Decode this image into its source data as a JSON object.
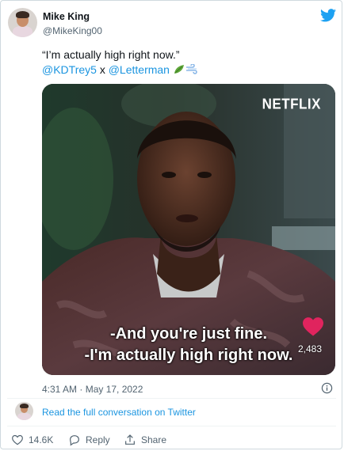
{
  "author": {
    "name": "Mike King",
    "handle": "@MikeKing00"
  },
  "tweet": {
    "line1": "“I’m actually high right now.”",
    "mention1": "@KDTrey5",
    "connector": " x ",
    "mention2": "@Letterman"
  },
  "media": {
    "brand": "NETFLIX",
    "subtitle_line1": "-And you're just fine.",
    "subtitle_line2": "-I'm actually high right now.",
    "heart_count": "2,483"
  },
  "timestamp": "4:31 AM · May 17, 2022",
  "read_more": "Read the full conversation on Twitter",
  "actions": {
    "likes": "14.6K",
    "reply": "Reply",
    "share": "Share"
  },
  "colors": {
    "link": "#1b95e0",
    "heart": "#e0245e",
    "bird": "#1da1f2"
  }
}
